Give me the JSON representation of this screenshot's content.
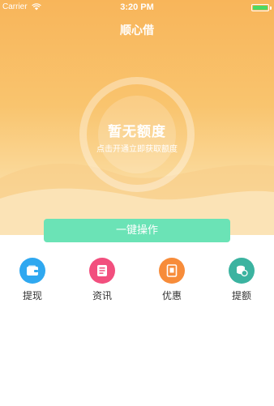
{
  "status_bar": {
    "carrier": "Carrier",
    "time": "3:20 PM"
  },
  "header": {
    "title": "顺心借"
  },
  "quota": {
    "title": "暂无额度",
    "subtitle": "点击开通立即获取额度"
  },
  "action": {
    "label": "一键操作"
  },
  "nav": [
    {
      "label": "提现",
      "icon": "wallet-icon",
      "color": "#2fa8f0"
    },
    {
      "label": "资讯",
      "icon": "news-icon",
      "color": "#f24f7e"
    },
    {
      "label": "优惠",
      "icon": "coupon-icon",
      "color": "#f78c3a"
    },
    {
      "label": "提额",
      "icon": "coin-stack-icon",
      "color": "#3bb3a0"
    }
  ],
  "colors": {
    "hero_top": "#f8b55a",
    "accent_button": "#6be3b6",
    "battery": "#4cd964"
  }
}
